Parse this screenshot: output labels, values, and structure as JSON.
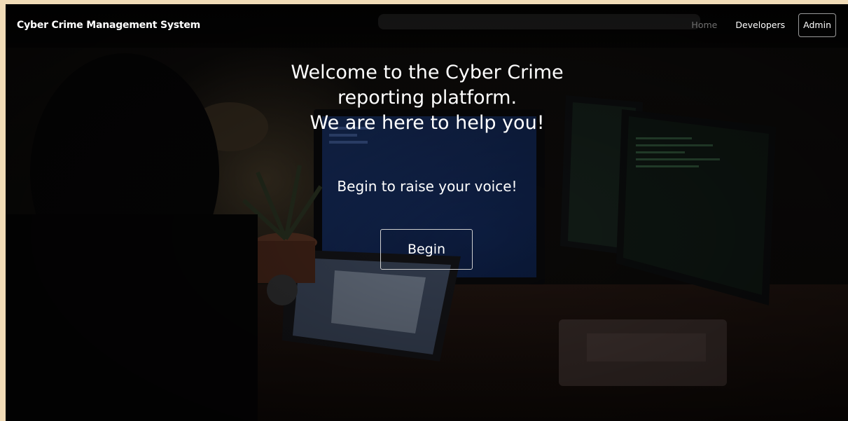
{
  "navbar": {
    "brand": "Cyber Crime Management System",
    "links": [
      {
        "label": "Home"
      },
      {
        "label": "Developers"
      },
      {
        "label": "Admin"
      }
    ]
  },
  "hero": {
    "title_lines": [
      "Welcome to the Cyber Crime",
      "reporting platform.",
      "We are here to help you!"
    ],
    "subtitle": "Begin to raise your voice!",
    "cta_label": "Begin"
  },
  "colors": {
    "page_border": "#f1dcb7",
    "nav_link_active": "#ffffff",
    "nav_link_muted": "#6f6f6f",
    "button_border": "#cfcfcf"
  }
}
